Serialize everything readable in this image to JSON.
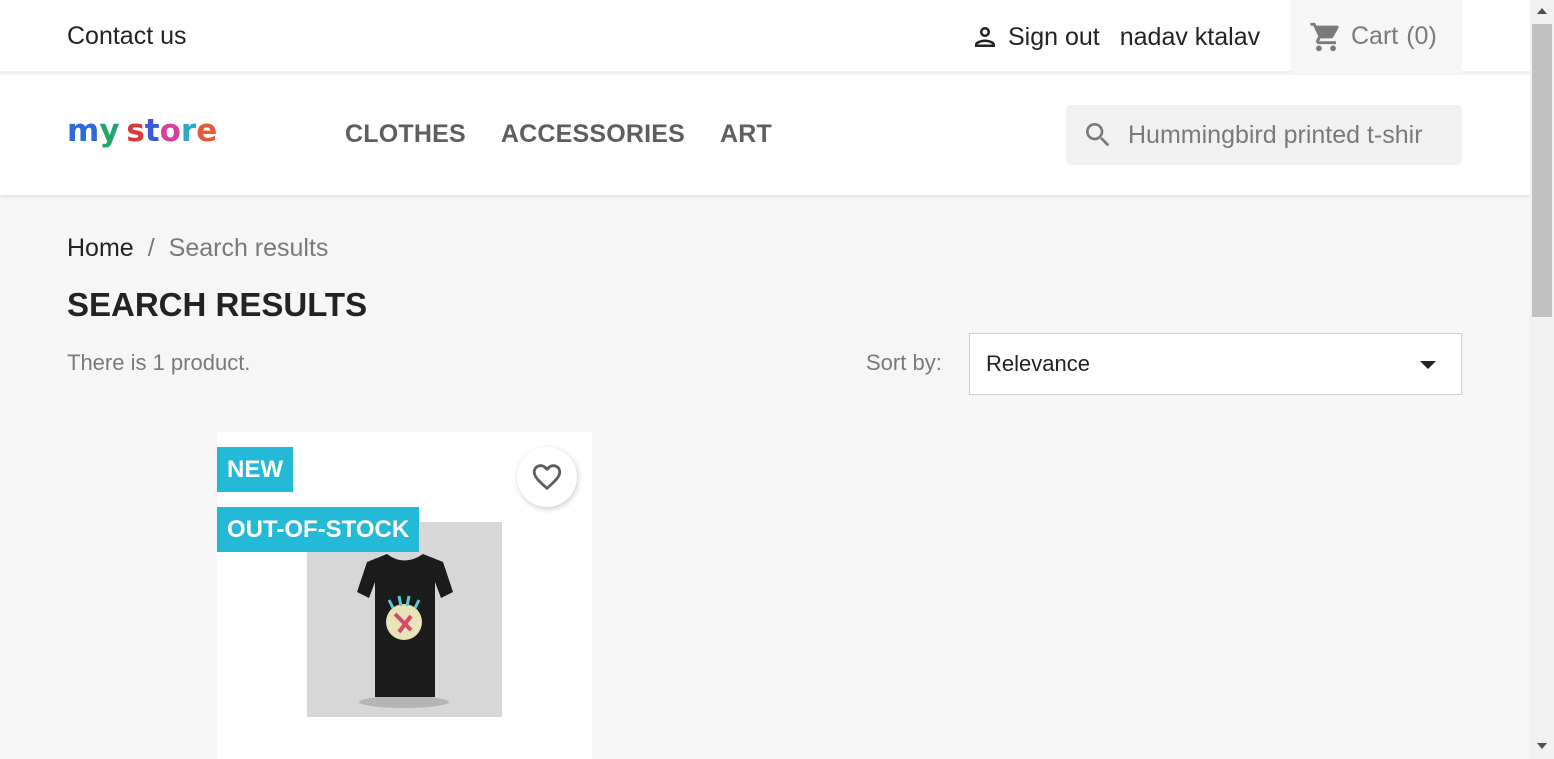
{
  "topnav": {
    "contact_label": "Contact us",
    "signout_label": "Sign out",
    "username": "nadav ktalav",
    "cart_label": "Cart",
    "cart_count": "(0)"
  },
  "header": {
    "logo": {
      "m": "m",
      "y": "y",
      "s": "s",
      "t": "t",
      "o": "o",
      "r": "r",
      "e": "e"
    },
    "menu": [
      {
        "label": "CLOTHES"
      },
      {
        "label": "ACCESSORIES"
      },
      {
        "label": "ART"
      }
    ],
    "search": {
      "value": "Hummingbird printed t-shir",
      "icon": "search-icon"
    }
  },
  "breadcrumb": {
    "home": "Home",
    "separator": "/",
    "current": "Search results"
  },
  "main": {
    "title": "SEARCH RESULTS",
    "product_count": "There is 1 product.",
    "sort_label": "Sort by:",
    "sort_value": "Relevance"
  },
  "product": {
    "flags": [
      "NEW",
      "OUT-OF-STOCK"
    ],
    "wishlist_icon": "heart-icon"
  },
  "colors": {
    "accent_flag": "#24b9d7",
    "background": "#f6f6f6"
  }
}
